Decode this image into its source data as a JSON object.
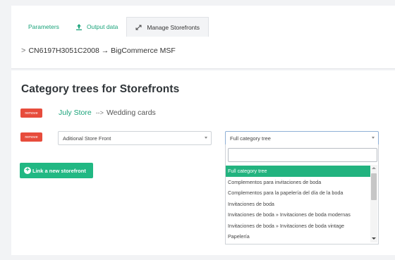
{
  "tabs": [
    {
      "label": "Parameters",
      "icon": "none"
    },
    {
      "label": "Output data",
      "icon": "upload-icon"
    },
    {
      "label": "Manage Storefronts",
      "icon": "expand-arrows-icon"
    }
  ],
  "breadcrumb": {
    "chevron": ">",
    "text": "CN6197H3051C2008 → BigCommerce MSF"
  },
  "heading": "Category trees for Storefronts",
  "mappings": [
    {
      "remove_label": "remove",
      "store": "July Store",
      "arrow": "-->",
      "category": "Wedding cards"
    },
    {
      "remove_label": "remove",
      "storefront_value": "Aditional Store Front",
      "tree_value": "Full category tree"
    }
  ],
  "link_button": {
    "label": "Link a new storefront",
    "icon": "plus-circle-icon"
  },
  "dropdown": {
    "search_value": "",
    "options": [
      "Full category tree",
      "Complementos para invitaciones de boda",
      "Complementos para la papelería del día de la boda",
      "Invitaciones de boda",
      "Invitaciones de boda » Invitaciones de boda modernas",
      "Invitaciones de boda » Invitaciones de boda vintage",
      "Papelería"
    ],
    "selected_index": 0
  },
  "colors": {
    "accent_green": "#21b883",
    "remove_red": "#e74c3c",
    "selected_option": "#22b37f"
  }
}
